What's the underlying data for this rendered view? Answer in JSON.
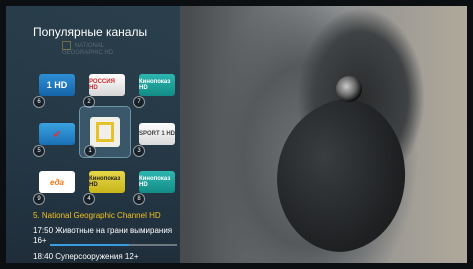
{
  "panel": {
    "title": "Популярные каналы",
    "ghost_logo_text": "NATIONAL GEOGRAPHIC HD"
  },
  "channels": [
    {
      "number": "6",
      "logo": "1 HD"
    },
    {
      "number": "2",
      "logo": "РОССИЯ HD"
    },
    {
      "number": "7",
      "logo": "Кинопоказ HD"
    },
    {
      "number": "5",
      "logo": "bird-logo"
    },
    {
      "number": "1",
      "logo": "national-geographic-logo"
    },
    {
      "number": "3",
      "logo": "SPORT 1 HD"
    },
    {
      "number": "9",
      "logo": "еда"
    },
    {
      "number": "4",
      "logo": "Кинопоказ HD"
    },
    {
      "number": "8",
      "logo": "Кинопоказ HD"
    }
  ],
  "now": {
    "channel": "5. National Geographic Channel HD",
    "program1": "17:50  Животные на грани вымирания 16+",
    "progress_percent": 62,
    "program2": "18:40  Суперсооружения 12+"
  },
  "colors": {
    "accent_yellow": "#f2c11e",
    "progress_blue": "#3a9be0"
  }
}
